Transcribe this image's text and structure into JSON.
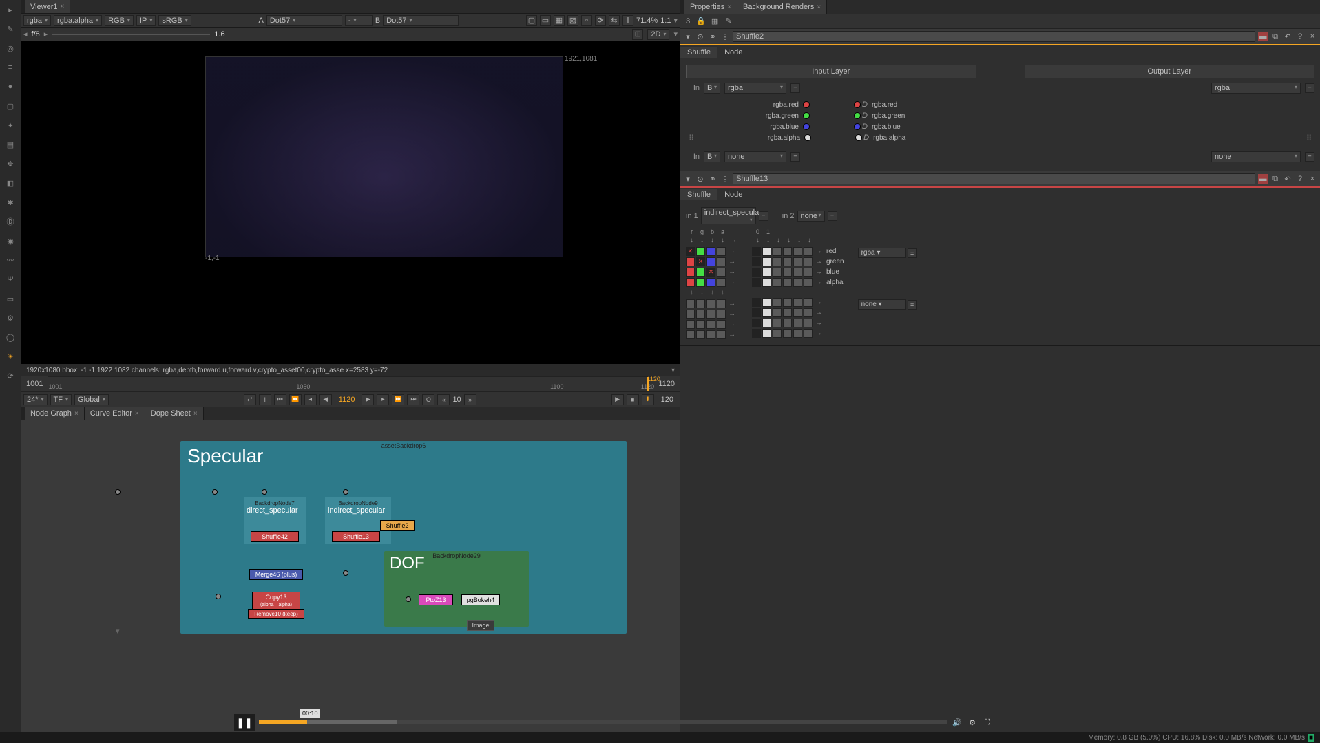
{
  "viewer": {
    "tab": "Viewer1",
    "channels": [
      "rgba",
      "rgba.alpha",
      "RGB",
      "IP",
      "sRGB"
    ],
    "inputA": {
      "label": "A",
      "value": "Dot57"
    },
    "inputB": {
      "label": "B",
      "value": "Dot57"
    },
    "zoom": "71.4%",
    "ratio": "1:1",
    "mode": "2D",
    "fstop": "f/8",
    "exposure": "1.6",
    "coords_tr": "1921,1081",
    "coords_bl": "-1,-1",
    "status": "1920x1080  bbox: -1 -1 1922 1082 channels: rgba,depth,forward.u,forward.v,crypto_asset00,crypto_asse  x=2583 y=-72"
  },
  "timeline": {
    "start": "1001",
    "end": "1120",
    "current": "1120",
    "ticks": [
      "1001",
      "1050",
      "1100",
      "1120"
    ],
    "fps": "24*",
    "tf": "TF",
    "global": "Global",
    "io": "10",
    "endFrame": "120"
  },
  "graph_tabs": [
    "Node Graph",
    "Curve Editor",
    "Dope Sheet"
  ],
  "nodegraph": {
    "backdrop_specular": {
      "label": "assetBackdrop6",
      "title": "Specular"
    },
    "backdrop_direct": {
      "label": "BackdropNode7",
      "title": "direct_specular",
      "node": "Shuffle42"
    },
    "backdrop_indirect": {
      "label": "BackdropNode9",
      "title": "indirect_specular",
      "node": "Shuffle13"
    },
    "shuffle2": "Shuffle2",
    "merge": "Merge46 (plus)",
    "copy": "Copy13",
    "copy_sub": "(alpha→alpha)",
    "remove": "Remove10 (keep)",
    "backdrop_dof": {
      "label": "BackdropNode29",
      "title": "DOF"
    },
    "ptoz": "PtoZ13",
    "pgbokeh": "pgBokeh4",
    "image": "Image"
  },
  "properties": {
    "tab1": "Properties",
    "tab2": "Background Renders",
    "count": "3"
  },
  "panel_shuffle2": {
    "name": "Shuffle2",
    "subtabs": [
      "Shuffle",
      "Node"
    ],
    "input_layer": "Input Layer",
    "output_layer": "Output Layer",
    "in_label": "In",
    "in_val": "B",
    "in_channel": "rgba",
    "out_channel": "rgba",
    "rows": [
      {
        "in": "rgba.red",
        "out": "rgba.red",
        "color": "red"
      },
      {
        "in": "rgba.green",
        "out": "rgba.green",
        "color": "green"
      },
      {
        "in": "rgba.blue",
        "out": "rgba.blue",
        "color": "blue"
      },
      {
        "in": "rgba.alpha",
        "out": "rgba.alpha",
        "color": "white"
      }
    ],
    "in2_label": "In",
    "in2_val": "B",
    "in2_channel": "none",
    "out2_channel": "none"
  },
  "panel_shuffle13": {
    "name": "Shuffle13",
    "subtabs": [
      "Shuffle",
      "Node"
    ],
    "in1_label": "in 1",
    "in1_val": "indirect_specular",
    "in2_label": "in 2",
    "in2_val": "none",
    "headers1": [
      "r",
      "g",
      "b",
      "a"
    ],
    "headers2": [
      "0",
      "1"
    ],
    "out_labels": [
      "red",
      "green",
      "blue",
      "alpha"
    ],
    "out_dd1": "rgba",
    "out_dd2": "none"
  },
  "video": {
    "time": "00:10"
  },
  "bottom": "Memory: 0.8 GB (5.0%) CPU: 16.8% Disk: 0.0 MB/s Network: 0.0 MB/s"
}
